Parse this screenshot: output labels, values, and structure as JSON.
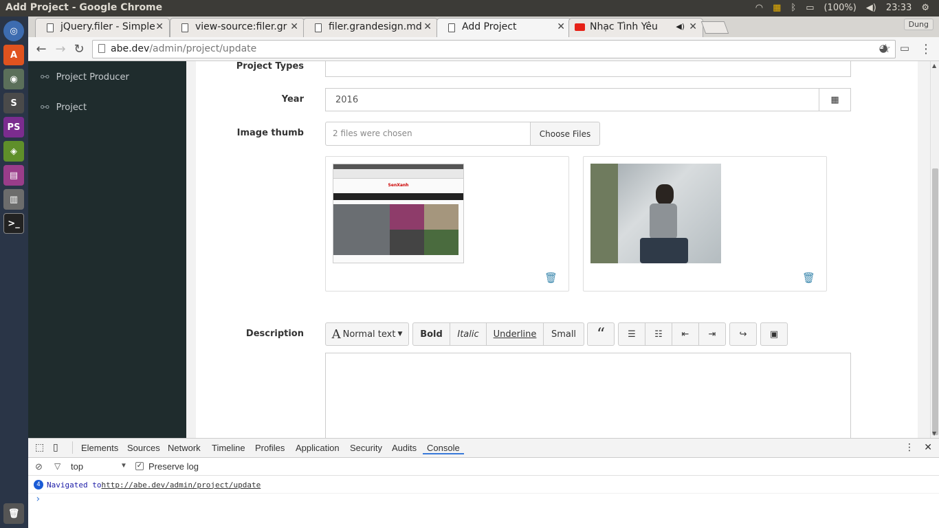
{
  "window": {
    "title": "Add Project - Google Chrome",
    "battery": "(100%)",
    "time": "23:33"
  },
  "tabs": [
    {
      "label": "jQuery.filer - Simple"
    },
    {
      "label": "view-source:filer.gr"
    },
    {
      "label": "filer.grandesign.md"
    },
    {
      "label": "Add Project"
    },
    {
      "label": "Nhạc Tình Yêu"
    }
  ],
  "profile": "Dung",
  "address": {
    "host": "abe.dev",
    "path": "/admin/project/update"
  },
  "sidebar": {
    "items": [
      {
        "label": "Project Producer"
      },
      {
        "label": "Project"
      }
    ]
  },
  "form": {
    "project_types_label": "Project Types",
    "year_label": "Year",
    "year_value": "2016",
    "image_label": "Image thumb",
    "image_status": "2 files were chosen",
    "choose_files": "Choose Files",
    "thumbnail_logo": "SenXanh",
    "description_label": "Description",
    "editor": {
      "normal_text": "Normal text",
      "bold": "Bold",
      "italic": "Italic",
      "underline": "Underline",
      "small": "Small",
      "quote": "“"
    }
  },
  "devtools": {
    "tabs": [
      "Elements",
      "Sources",
      "Network",
      "Timeline",
      "Profiles",
      "Application",
      "Security",
      "Audits",
      "Console"
    ],
    "active_tab": "Console",
    "context": "top",
    "preserve_log": "Preserve log",
    "message_count": "4",
    "message_prefix": "Navigated to ",
    "message_url": "http://abe.dev/admin/project/update",
    "prompt": "›"
  }
}
